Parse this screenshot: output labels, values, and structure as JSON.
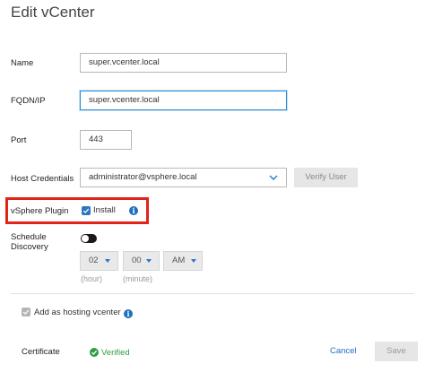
{
  "dialog": {
    "title": "Edit vCenter"
  },
  "form": {
    "name": {
      "label": "Name",
      "value": "super.vcenter.local"
    },
    "fqdn": {
      "label": "FQDN/IP",
      "value": "super.vcenter.local"
    },
    "port": {
      "label": "Port",
      "value": "443"
    },
    "credentials": {
      "label": "Host Credentials",
      "value": "administrator@vsphere.local",
      "verify_button": "Verify User"
    },
    "vsphere_plugin": {
      "label": "vSphere Plugin",
      "checkbox_label": "Install",
      "checked": true
    },
    "schedule_discovery": {
      "label_line1": "Schedule",
      "label_line2": "Discovery",
      "enabled": false,
      "hour": {
        "value": "02",
        "hint": "(hour)"
      },
      "minute": {
        "value": "00",
        "hint": "(minute)"
      },
      "ampm": {
        "value": "AM"
      }
    },
    "hosting_vcenter": {
      "label": "Add as hosting vcenter",
      "checked": true,
      "disabled": true
    },
    "certificate": {
      "label": "Certificate",
      "status": "Verified"
    }
  },
  "footer": {
    "cancel_label": "Cancel",
    "save_label": "Save"
  },
  "colors": {
    "accent": "#2b78c2",
    "highlight": "#e2231a",
    "success": "#2e9e3e"
  },
  "icons": [
    "info-icon",
    "chevron-down-icon",
    "check-icon",
    "verified-check-icon",
    "dropdown-triangle-icon"
  ]
}
